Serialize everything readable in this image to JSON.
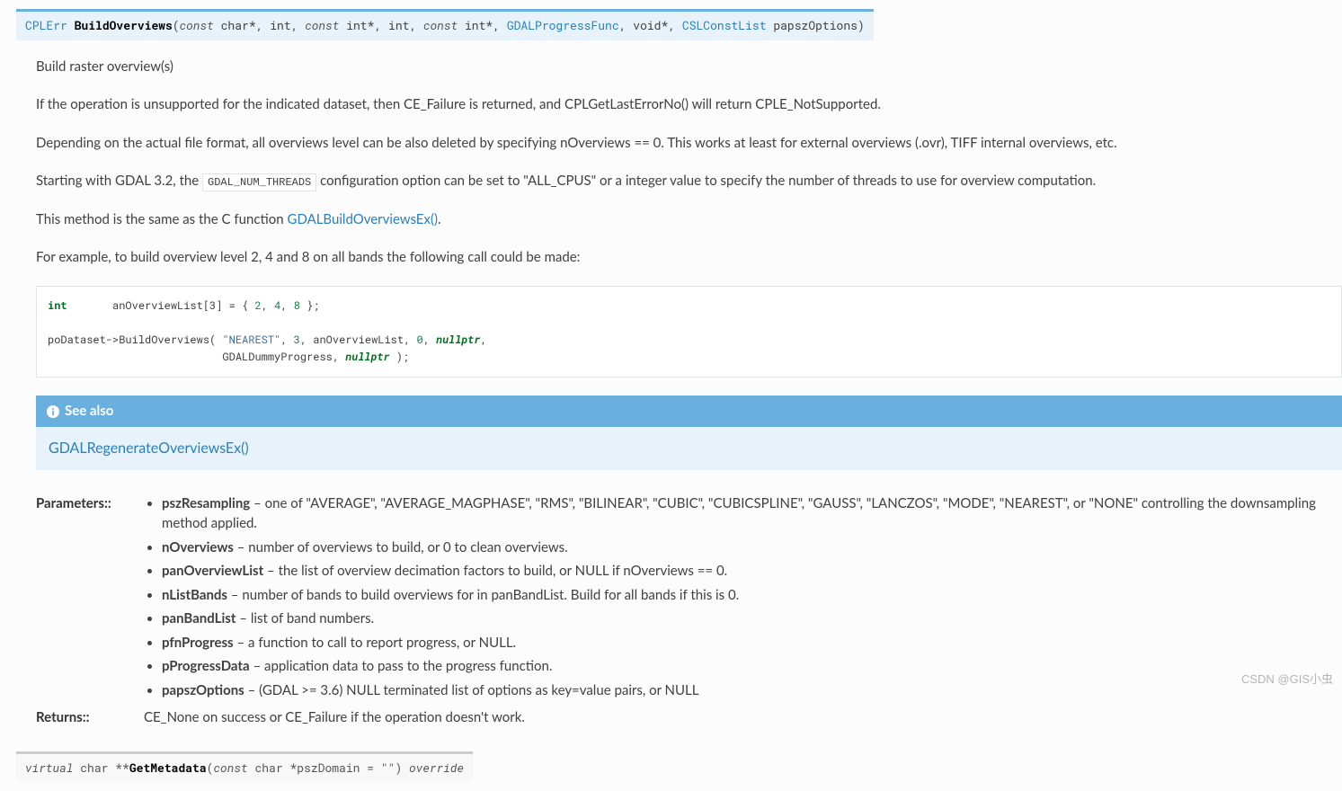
{
  "sig1": {
    "ret": "CPLErr",
    "name": "BuildOverviews",
    "parts": {
      "const": "const",
      "char_ptr": " char*",
      "int": "int",
      "int_ptr": " int*",
      "progress_func": "GDALProgressFunc",
      "void_ptr": "void*",
      "csl": "CSLConstList",
      "papsz": " papszOptions"
    }
  },
  "desc": {
    "p1": "Build raster overview(s)",
    "p2": "If the operation is unsupported for the indicated dataset, then CE_Failure is returned, and CPLGetLastErrorNo() will return CPLE_NotSupported.",
    "p3": "Depending on the actual file format, all overviews level can be also deleted by specifying nOverviews == 0. This works at least for external overviews (.ovr), TIFF internal overviews, etc.",
    "p4a": "Starting with GDAL 3.2, the ",
    "p4code": "GDAL_NUM_THREADS",
    "p4b": " configuration option can be set to \"ALL_CPUS\" or a integer value to specify the number of threads to use for overview computation.",
    "p5a": "This method is the same as the C function ",
    "p5link": "GDALBuildOverviewsEx()",
    "p5b": ".",
    "p6": "For example, to build overview level 2, 4 and 8 on all bands the following call could be made:"
  },
  "code": {
    "kw_int": "int",
    "line1_rest": "       anOverviewList[3] = { ",
    "n1": "2",
    "n2": "4",
    "n3": "8",
    "line1_end": " };",
    "line2a": "poDataset->BuildOverviews( ",
    "str_nearest": "\"NEAREST\"",
    "line2b": ", ",
    "three": "3",
    "line2c": ", anOverviewList, ",
    "zero": "0",
    "line2d": ", ",
    "nullp": "nullptr",
    "line2e": ",",
    "line3a": "                           GDALDummyProgress, ",
    "line3b": " );"
  },
  "seealso": {
    "title": "See also",
    "link": "GDALRegenerateOverviewsEx()"
  },
  "fields": {
    "paramLabel": "Parameters::",
    "returnsLabel": "Returns::",
    "returnsText": "CE_None on success or CE_Failure if the operation doesn't work.",
    "params": [
      {
        "name": "pszResampling",
        "desc": " – one of \"AVERAGE\", \"AVERAGE_MAGPHASE\", \"RMS\", \"BILINEAR\", \"CUBIC\", \"CUBICSPLINE\", \"GAUSS\", \"LANCZOS\", \"MODE\", \"NEAREST\", or \"NONE\" controlling the downsampling method applied."
      },
      {
        "name": "nOverviews",
        "desc": " – number of overviews to build, or 0 to clean overviews."
      },
      {
        "name": "panOverviewList",
        "desc": " – the list of overview decimation factors to build, or NULL if nOverviews == 0."
      },
      {
        "name": "nListBands",
        "desc": " – number of bands to build overviews for in panBandList. Build for all bands if this is 0."
      },
      {
        "name": "panBandList",
        "desc": " – list of band numbers."
      },
      {
        "name": "pfnProgress",
        "desc": " – a function to call to report progress, or NULL."
      },
      {
        "name": "pProgressData",
        "desc": " – application data to pass to the progress function."
      },
      {
        "name": "papszOptions",
        "desc": " – (GDAL >= 3.6) NULL terminated list of options as key=value pairs, or NULL"
      }
    ]
  },
  "sig2": {
    "virtual": "virtual",
    "ret": " char **",
    "name": "GetMetadata",
    "open": "(",
    "const": "const",
    "args": " char *pszDomain = \"\") ",
    "override": "override"
  },
  "watermark": "CSDN @GIS小虫"
}
